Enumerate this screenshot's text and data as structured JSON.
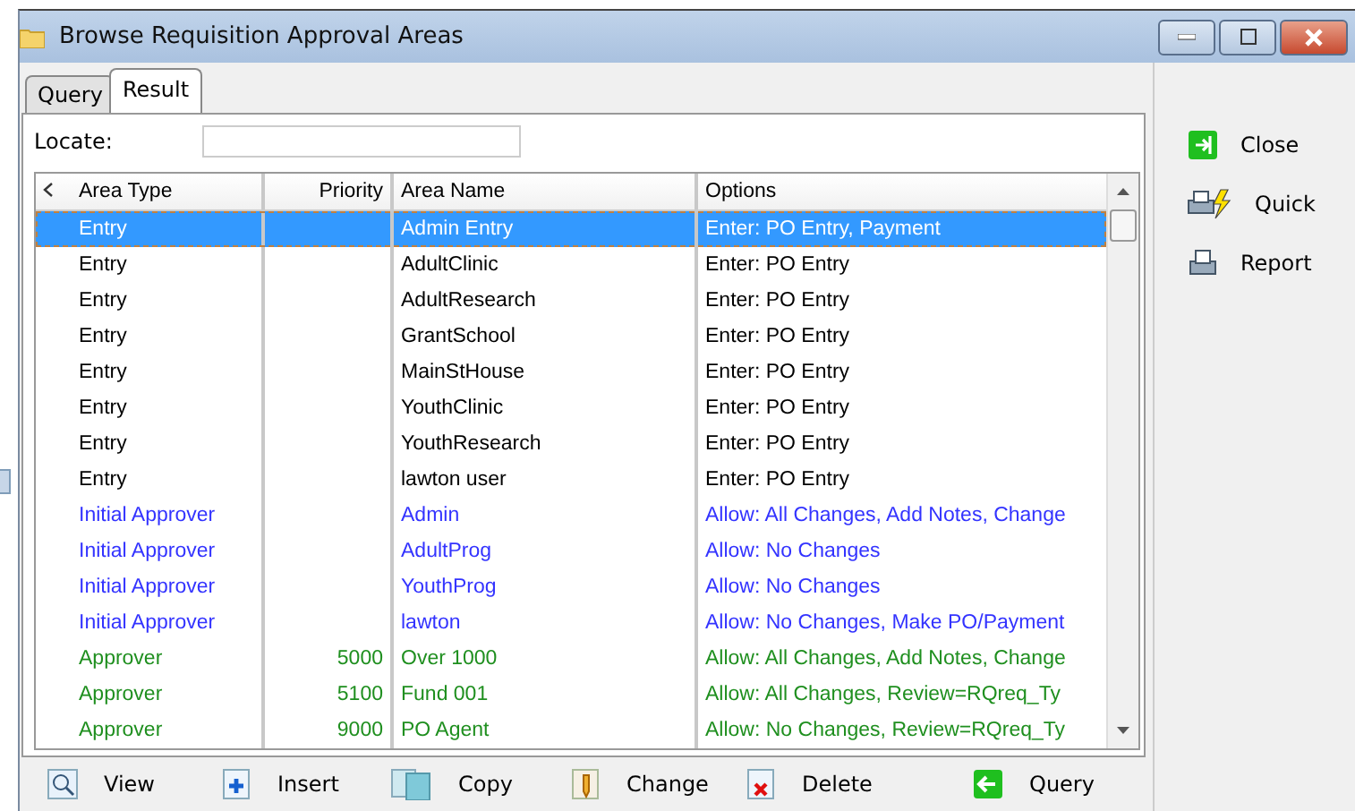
{
  "window": {
    "title": "Browse Requisition Approval Areas"
  },
  "tabs": [
    {
      "label": "Query",
      "selected": false
    },
    {
      "label": "Result",
      "selected": true
    }
  ],
  "locate": {
    "label": "Locate:"
  },
  "table": {
    "columns": [
      "Area Type",
      "Priority",
      "Area Name",
      "Options"
    ],
    "rows": [
      {
        "area_type": "Entry",
        "priority": "",
        "area_name": "Admin Entry",
        "options": "Enter: PO Entry, Payment",
        "selected": true
      },
      {
        "area_type": "Entry",
        "priority": "",
        "area_name": "AdultClinic",
        "options": "Enter: PO Entry",
        "color": "#000000",
        "selected": false
      },
      {
        "area_type": "Entry",
        "priority": "",
        "area_name": "AdultResearch",
        "options": "Enter: PO Entry",
        "color": "#000000",
        "selected": false
      },
      {
        "area_type": "Entry",
        "priority": "",
        "area_name": "GrantSchool",
        "options": "Enter: PO Entry",
        "color": "#000000",
        "selected": false
      },
      {
        "area_type": "Entry",
        "priority": "",
        "area_name": "MainStHouse",
        "options": "Enter: PO Entry",
        "color": "#000000",
        "selected": false
      },
      {
        "area_type": "Entry",
        "priority": "",
        "area_name": "YouthClinic",
        "options": "Enter: PO Entry",
        "color": "#000000",
        "selected": false
      },
      {
        "area_type": "Entry",
        "priority": "",
        "area_name": "YouthResearch",
        "options": "Enter: PO Entry",
        "color": "#000000",
        "selected": false
      },
      {
        "area_type": "Entry",
        "priority": "",
        "area_name": "lawton user",
        "options": "Enter: PO Entry",
        "color": "#000000",
        "selected": false
      },
      {
        "area_type": "Initial Approver",
        "priority": "",
        "area_name": "Admin",
        "options": "Allow: All Changes, Add Notes, Change",
        "color": "#3333ff",
        "selected": false
      },
      {
        "area_type": "Initial Approver",
        "priority": "",
        "area_name": "AdultProg",
        "options": "Allow: No Changes",
        "color": "#3333ff",
        "selected": false
      },
      {
        "area_type": "Initial Approver",
        "priority": "",
        "area_name": "YouthProg",
        "options": "Allow: No Changes",
        "color": "#3333ff",
        "selected": false
      },
      {
        "area_type": "Initial Approver",
        "priority": "",
        "area_name": "lawton",
        "options": "Allow: No Changes, Make PO/Payment",
        "color": "#3333ff",
        "selected": false
      },
      {
        "area_type": "Approver",
        "priority": "5000",
        "area_name": "Over 1000",
        "options": "Allow: All Changes, Add Notes, Change",
        "color": "#1f8f1f",
        "selected": false
      },
      {
        "area_type": "Approver",
        "priority": "5100",
        "area_name": "Fund 001",
        "options": "Allow: All Changes, Review=RQreq_Ty",
        "color": "#1f8f1f",
        "selected": false
      },
      {
        "area_type": "Approver",
        "priority": "9000",
        "area_name": "PO Agent",
        "options": "Allow: No Changes, Review=RQreq_Ty",
        "color": "#1f8f1f",
        "selected": false
      }
    ]
  },
  "side_buttons": [
    {
      "label": "Close",
      "kind": "close"
    },
    {
      "label": "Quick",
      "kind": "quick"
    },
    {
      "label": "Report",
      "kind": "report"
    }
  ],
  "bottom_buttons": [
    {
      "label": "View",
      "kind": "view"
    },
    {
      "label": "Insert",
      "kind": "insert"
    },
    {
      "label": "Copy",
      "kind": "copy"
    },
    {
      "label": "Change",
      "kind": "change"
    },
    {
      "label": "Delete",
      "kind": "delete"
    },
    {
      "label": "Query",
      "kind": "query"
    }
  ]
}
